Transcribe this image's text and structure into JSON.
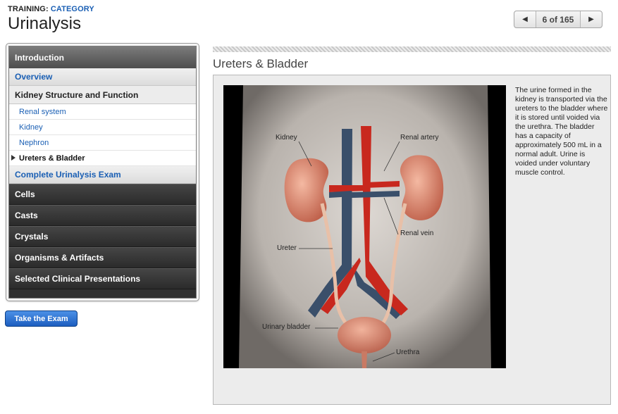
{
  "header": {
    "training_label": "TRAINING:",
    "category_label": "CATEGORY",
    "title": "Urinalysis"
  },
  "pager": {
    "prev_icon": "triangle-left-icon",
    "count": "6 of 165",
    "next_icon": "triangle-right-icon"
  },
  "sidebar": {
    "header": "Introduction",
    "overview": "Overview",
    "section": "Kidney Structure and Function",
    "sub_items": [
      {
        "label": "Renal system"
      },
      {
        "label": "Kidney"
      },
      {
        "label": "Nephron"
      },
      {
        "label": "Ureters & Bladder",
        "active": true
      }
    ],
    "complete_exam": "Complete Urinalysis Exam",
    "groups": [
      {
        "label": "Cells"
      },
      {
        "label": "Casts"
      },
      {
        "label": "Crystals"
      },
      {
        "label": "Organisms & Artifacts"
      },
      {
        "label": "Selected Clinical Presentations"
      }
    ]
  },
  "exam_button": "Take the Exam",
  "content": {
    "title": "Ureters & Bladder",
    "illustration_labels": {
      "kidney": "Kidney",
      "renal_artery": "Renal artery",
      "renal_vein": "Renal vein",
      "ureter": "Ureter",
      "bladder": "Urinary bladder",
      "urethra": "Urethra"
    },
    "description": "The urine formed in the kidney is transported via the ureters to the bladder where it is stored until voided via the urethra. The bladder has a capacity of approximately 500 mL in a normal adult. Urine is voided under voluntary muscle control."
  },
  "colors": {
    "link_blue": "#1a5fb4",
    "artery_red": "#c8281e",
    "vein_blue": "#3a4f6a",
    "kidney": "#d9806a",
    "button_blue": "#2a6fd0"
  }
}
